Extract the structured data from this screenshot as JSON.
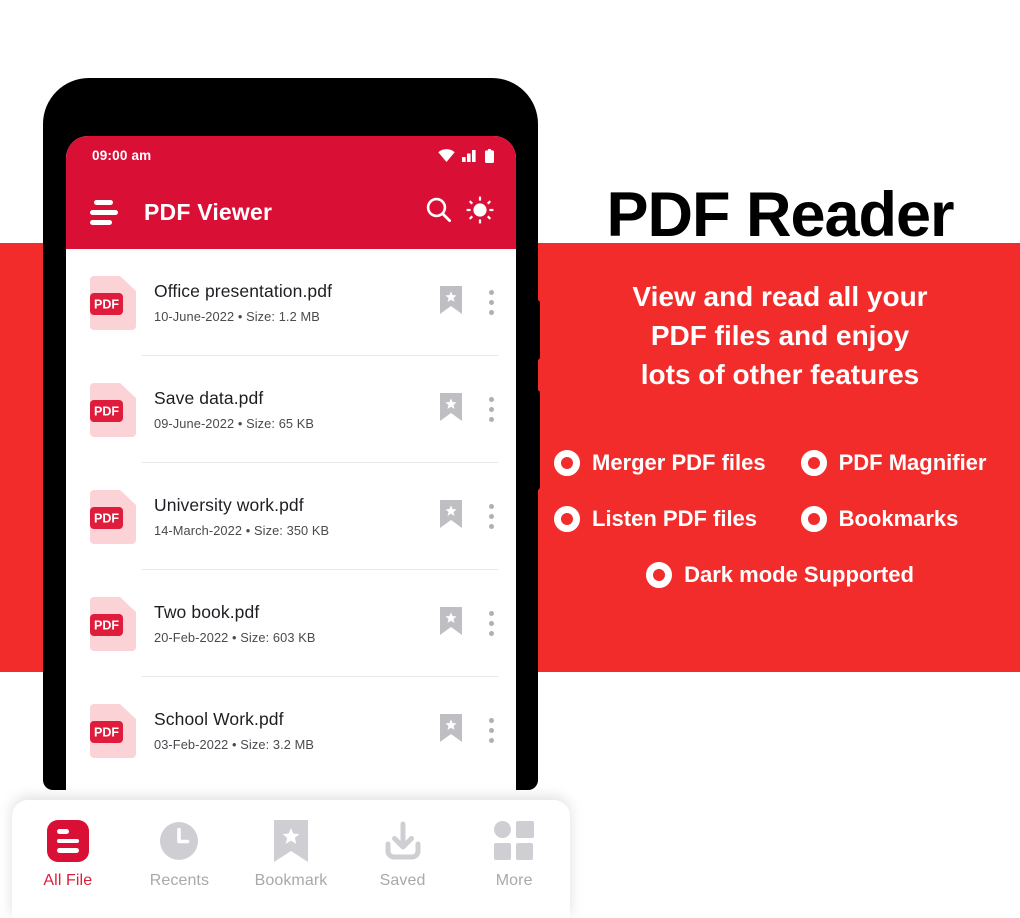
{
  "promo": {
    "title": "PDF Reader",
    "subtitle_lines": [
      "View and read all your",
      "PDF files and enjoy",
      "lots of other features"
    ],
    "features": [
      "Merger PDF files",
      "PDF Magnifier",
      "Listen PDF files",
      "Bookmarks",
      "Dark mode Supported"
    ],
    "band_color": "#F22B2B",
    "title_color": "#000000"
  },
  "phone": {
    "statusbar": {
      "time": "09:00 am",
      "icons": [
        "wifi-icon",
        "signal-icon",
        "battery-icon"
      ]
    },
    "appbar": {
      "title": "PDF Viewer",
      "menu_icon": "hamburger-icon",
      "search_icon": "search-icon",
      "brightness_icon": "brightness-icon",
      "color": "#DA0F35"
    },
    "files": [
      {
        "name": "Office presentation.pdf",
        "date": "10-June-2022",
        "size": "Size: 1.2 MB",
        "badge": "PDF"
      },
      {
        "name": "Save data.pdf",
        "date": "09-June-2022",
        "size": "Size: 65 KB",
        "badge": "PDF"
      },
      {
        "name": "University work.pdf",
        "date": "14-March-2022",
        "size": "Size: 350 KB",
        "badge": "PDF"
      },
      {
        "name": "Two book.pdf",
        "date": "20-Feb-2022",
        "size": "Size: 603 KB",
        "badge": "PDF"
      },
      {
        "name": "School Work.pdf",
        "date": "03-Feb-2022",
        "size": "Size: 3.2 MB",
        "badge": "PDF"
      }
    ],
    "separator": "•"
  },
  "bottomnav": {
    "items": [
      {
        "label": "All File",
        "icon": "all-file-icon",
        "active": true
      },
      {
        "label": "Recents",
        "icon": "clock-icon",
        "active": false
      },
      {
        "label": "Bookmark",
        "icon": "bookmark-icon",
        "active": false
      },
      {
        "label": "Saved",
        "icon": "download-icon",
        "active": false
      },
      {
        "label": "More",
        "icon": "grid-icon",
        "active": false
      }
    ],
    "active_color": "#E01C3C",
    "inactive_color": "#A9A9AD"
  }
}
